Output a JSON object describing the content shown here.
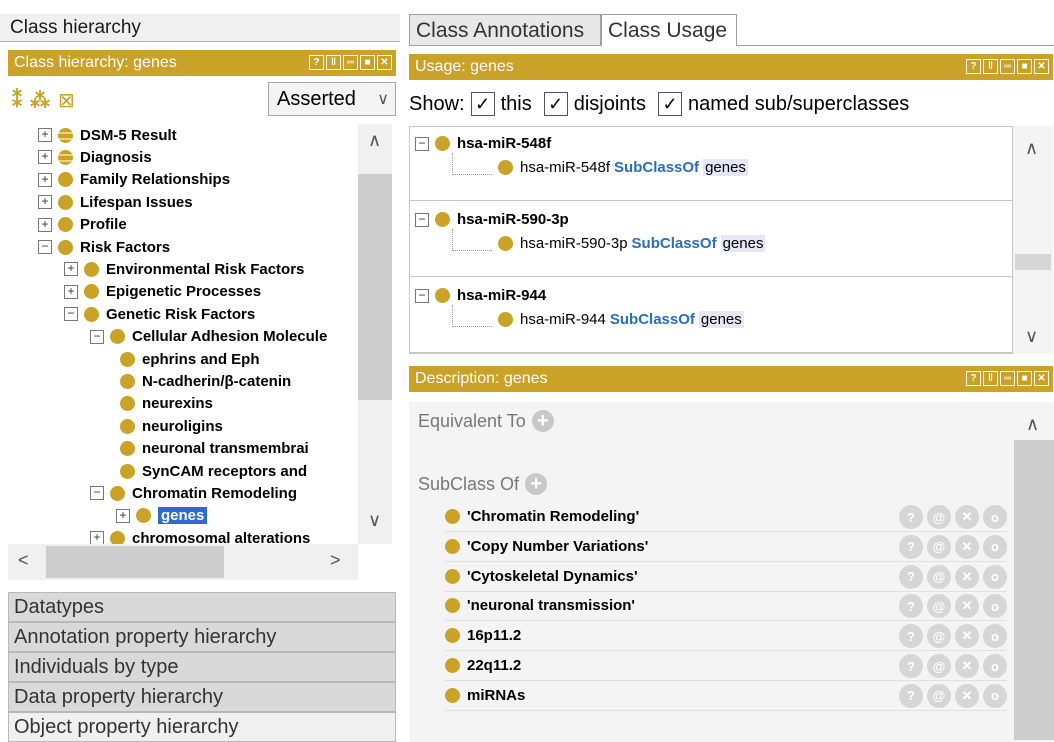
{
  "left": {
    "view_title": "Class hierarchy",
    "panel_title": "Class hierarchy: genes",
    "mode_select": "Asserted",
    "tree": [
      {
        "label": "DSM-5 Result",
        "depth": 0,
        "toggle": "+",
        "icon": "stripe"
      },
      {
        "label": "Diagnosis",
        "depth": 0,
        "toggle": "+",
        "icon": "stripe"
      },
      {
        "label": "Family Relationships",
        "depth": 0,
        "toggle": "+",
        "icon": "plain"
      },
      {
        "label": "Lifespan Issues",
        "depth": 0,
        "toggle": "+",
        "icon": "plain"
      },
      {
        "label": "Profile",
        "depth": 0,
        "toggle": "+",
        "icon": "plain"
      },
      {
        "label": "Risk Factors",
        "depth": 0,
        "toggle": "−",
        "icon": "plain"
      },
      {
        "label": "Environmental Risk Factors",
        "depth": 1,
        "toggle": "+",
        "icon": "plain"
      },
      {
        "label": "Epigenetic Processes",
        "depth": 1,
        "toggle": "+",
        "icon": "plain"
      },
      {
        "label": "Genetic Risk Factors",
        "depth": 1,
        "toggle": "−",
        "icon": "plain"
      },
      {
        "label": "Cellular Adhesion Molecule",
        "depth": 2,
        "toggle": "−",
        "icon": "plain"
      },
      {
        "label": "ephrins and Eph",
        "depth": 3,
        "toggle": "",
        "icon": "plain"
      },
      {
        "label": "N-cadherin/β-catenin",
        "depth": 3,
        "toggle": "",
        "icon": "plain"
      },
      {
        "label": "neurexins",
        "depth": 3,
        "toggle": "",
        "icon": "plain"
      },
      {
        "label": "neuroligins",
        "depth": 3,
        "toggle": "",
        "icon": "plain"
      },
      {
        "label": "neuronal transmembrai",
        "depth": 3,
        "toggle": "",
        "icon": "plain"
      },
      {
        "label": "SynCAM receptors and",
        "depth": 3,
        "toggle": "",
        "icon": "plain"
      },
      {
        "label": "Chromatin Remodeling",
        "depth": 2,
        "toggle": "−",
        "icon": "plain"
      },
      {
        "label": "genes",
        "depth": 3,
        "toggle": "+",
        "icon": "plain",
        "selected": true
      },
      {
        "label": "chromosomal alterations",
        "depth": 2,
        "toggle": "+",
        "icon": "plain"
      }
    ],
    "bottom_tabs": [
      "Datatypes",
      "Annotation property hierarchy",
      "Individuals by type",
      "Data property hierarchy",
      "Object property hierarchy"
    ]
  },
  "right": {
    "tabs": [
      "Class Annotations",
      "Class Usage"
    ],
    "usage_title": "Usage: genes",
    "show_label": "Show:",
    "show_options": [
      "this",
      "disjoints",
      "named sub/superclasses"
    ],
    "usages": [
      {
        "title": "hsa-miR-548f",
        "subject": "hsa-miR-548f",
        "keyword": "SubClassOf",
        "object": "genes"
      },
      {
        "title": "hsa-miR-590-3p",
        "subject": "hsa-miR-590-3p",
        "keyword": "SubClassOf",
        "object": "genes"
      },
      {
        "title": "hsa-miR-944",
        "subject": "hsa-miR-944",
        "keyword": "SubClassOf",
        "object": "genes"
      }
    ],
    "description_title": "Description: genes",
    "equivalent_label": "Equivalent To",
    "subclass_label": "SubClass Of",
    "subclasses": [
      "'Chromatin Remodeling'",
      "'Copy Number Variations'",
      "'Cytoskeletal Dynamics'",
      "'neuronal transmission'",
      "16p11.2",
      "22q11.2",
      "miRNAs"
    ]
  },
  "colors": {
    "accent": "#c9a227",
    "selection": "#2e6bd1",
    "keyword": "#2a6ebb"
  }
}
